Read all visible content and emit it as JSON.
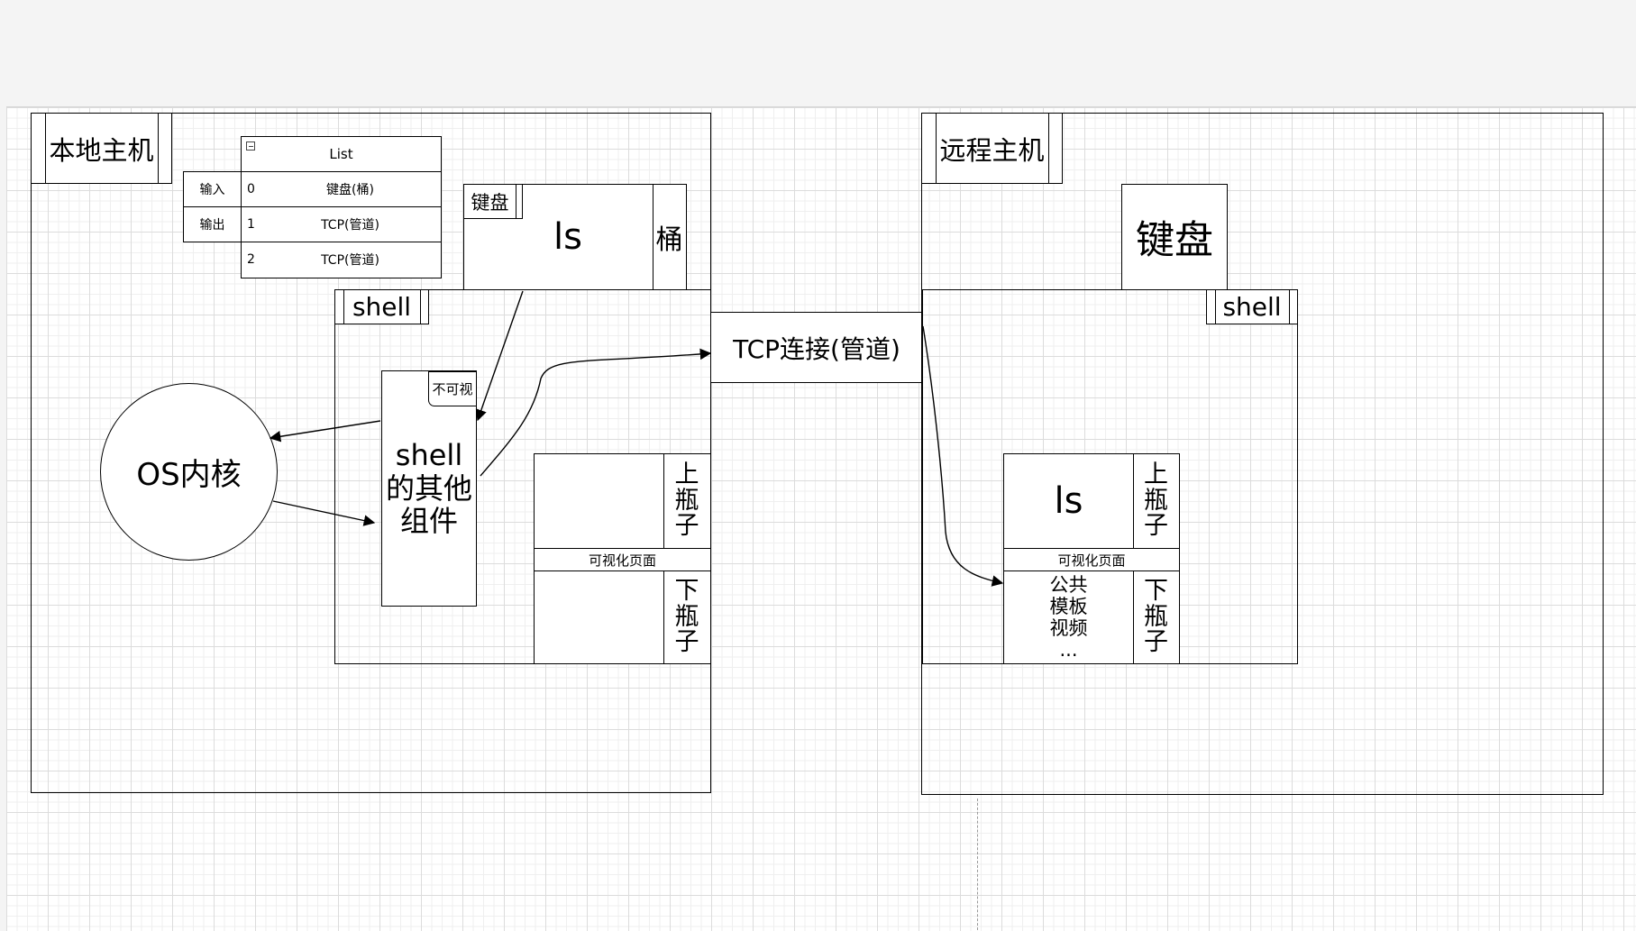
{
  "local_host": {
    "title": "本地主机",
    "list": {
      "header": "List",
      "collapse_icon": "minus-square-icon",
      "rows": [
        {
          "index": "0",
          "value": "键盘(桶)"
        },
        {
          "index": "1",
          "value": "TCP(管道)"
        },
        {
          "index": "2",
          "value": "TCP(管道)"
        }
      ],
      "side_labels": [
        "输入",
        "输出"
      ]
    },
    "keyboard_label": "键盘",
    "ls_label": "ls",
    "bucket_label": "桶",
    "shell_label": "shell",
    "shell_other": [
      "shell",
      "的其他",
      "组件"
    ],
    "invisible_label": "不可视",
    "os_kernel": "OS内核",
    "upper_bottle": [
      "上",
      "瓶",
      "子"
    ],
    "visible_page": "可视化页面",
    "lower_bottle": [
      "下",
      "瓶",
      "子"
    ]
  },
  "tcp_connection": "TCP连接(管道)",
  "remote_host": {
    "title": "远程主机",
    "keyboard": "键盘",
    "shell_label": "shell",
    "ls_label": "ls",
    "upper_bottle": [
      "上",
      "瓶",
      "子"
    ],
    "visible_page": "可视化页面",
    "public_items": [
      "公共",
      "模板",
      "视频",
      "..."
    ],
    "lower_bottle": [
      "下",
      "瓶",
      "子"
    ]
  }
}
